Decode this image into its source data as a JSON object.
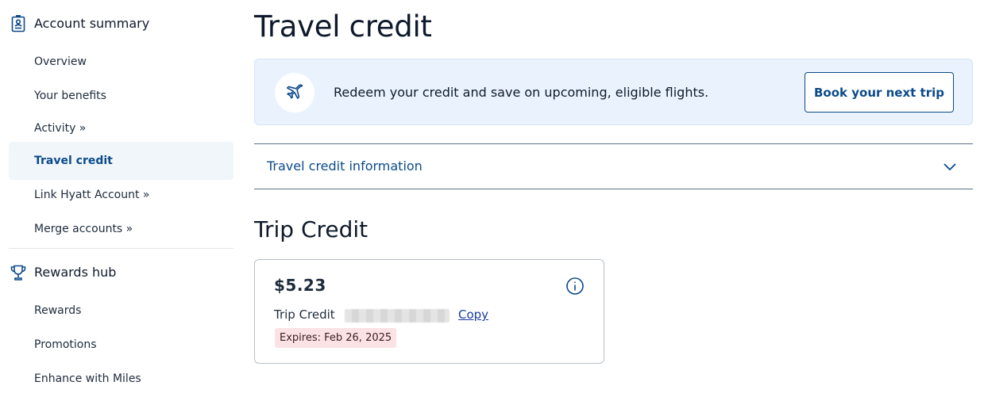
{
  "sidebar": {
    "account_summary": {
      "label": "Account summary",
      "icon": "id-badge-icon",
      "items": [
        {
          "label": "Overview"
        },
        {
          "label": "Your benefits"
        },
        {
          "label": "Activity »"
        },
        {
          "label": "Travel credit",
          "active": true
        },
        {
          "label": "Link Hyatt Account »"
        },
        {
          "label": "Merge accounts »"
        }
      ]
    },
    "rewards_hub": {
      "label": "Rewards hub",
      "icon": "trophy-icon",
      "items": [
        {
          "label": "Rewards"
        },
        {
          "label": "Promotions"
        },
        {
          "label": "Enhance with Miles"
        }
      ]
    }
  },
  "main": {
    "title": "Travel credit",
    "promo": {
      "icon": "airplane-icon",
      "text": "Redeem your credit and save on upcoming, eligible flights.",
      "button_label": "Book your next trip"
    },
    "accordion": {
      "label": "Travel credit information",
      "icon": "chevron-down-icon"
    },
    "section_title": "Trip Credit",
    "credit_card": {
      "amount": "$5.23",
      "label": "Trip Credit",
      "copy_label": "Copy",
      "expires": "Expires: Feb 26, 2025",
      "info_icon": "info-icon"
    }
  },
  "colors": {
    "accent": "#0b4a8a",
    "promo_bg": "#eaf3fd",
    "active_bg": "#f1f6fb",
    "expires_bg": "#fbe2e4"
  }
}
